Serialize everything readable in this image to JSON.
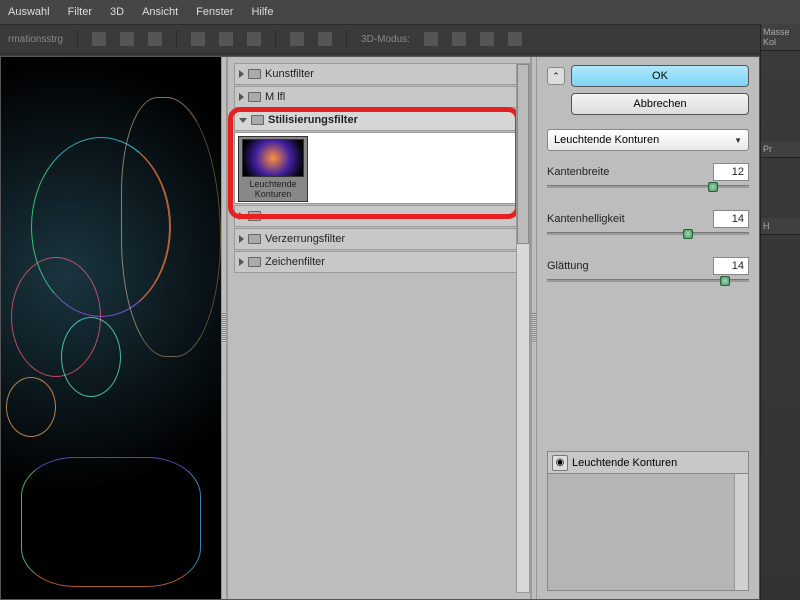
{
  "menu": {
    "items": [
      "Auswahl",
      "Filter",
      "3D",
      "Ansicht",
      "Fenster",
      "Hilfe"
    ]
  },
  "toolbar": {
    "label_left": "rmationsstrg",
    "label_3d": "3D-Modus:"
  },
  "right_panel": {
    "tab1": "Masse Kol",
    "tab2": "Pr",
    "tab3": "H"
  },
  "browser": {
    "cat_kunst": "Kunstfilter",
    "cat_mal": "M  lfl",
    "cat_stil": "Stilisierungsfilter",
    "cat_struktur": "",
    "cat_verzerr": "Verzerrungsfilter",
    "cat_zeichen": "Zeichenfilter",
    "thumb_label": "Leuchtende Konturen"
  },
  "controls": {
    "ok": "OK",
    "cancel": "Abbrechen",
    "filter_name": "Leuchtende Konturen",
    "slider1_label": "Kantenbreite",
    "slider1_value": "12",
    "slider2_label": "Kantenhelligkeit",
    "slider2_value": "14",
    "slider3_label": "Glättung",
    "slider3_value": "14"
  },
  "layers": {
    "title": "Leuchtende Konturen"
  }
}
